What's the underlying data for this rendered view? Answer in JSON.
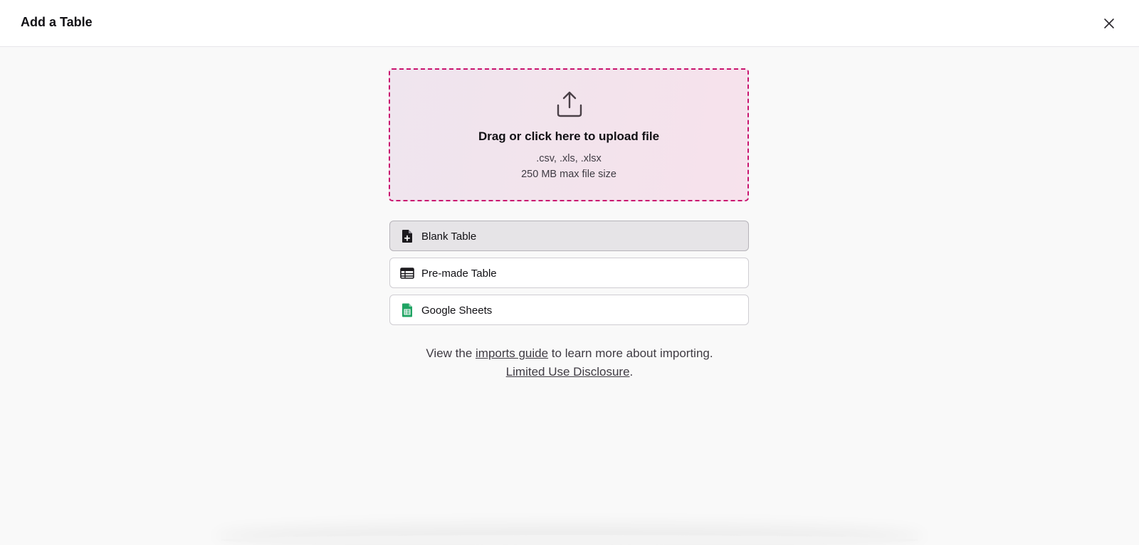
{
  "dialog": {
    "title": "Add a Table",
    "close_icon": "close-icon"
  },
  "upload": {
    "icon": "upload-icon",
    "title": "Drag or click here to upload file",
    "file_types": ".csv, .xls, .xlsx",
    "max_size": "250 MB max file size",
    "accent_color": "#c9146f"
  },
  "options": [
    {
      "label": "Blank Table",
      "icon": "file-plus-icon",
      "selected": true
    },
    {
      "label": "Pre-made Table",
      "icon": "table-icon",
      "selected": false
    },
    {
      "label": "Google Sheets",
      "icon": "google-sheets-icon",
      "selected": false
    }
  ],
  "footer": {
    "line1_prefix": "View the ",
    "imports_link": "imports guide",
    "line1_suffix": " to learn more about importing.",
    "disclosure_link": "Limited Use Disclosure",
    "line2_suffix": "."
  }
}
